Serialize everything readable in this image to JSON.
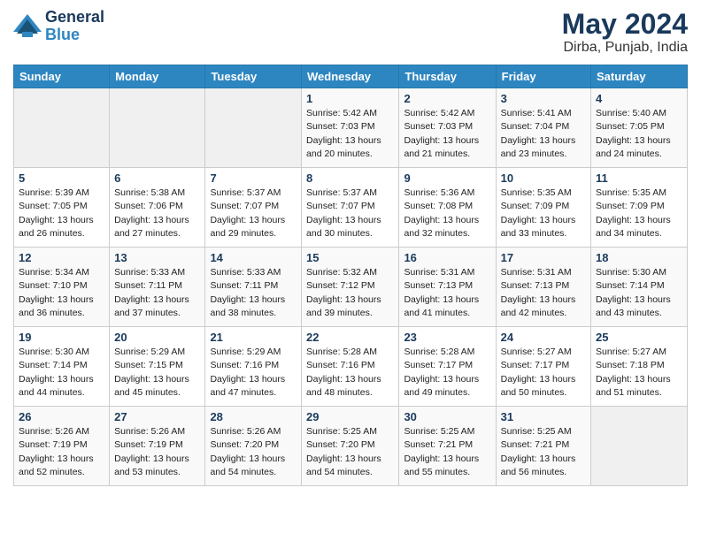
{
  "header": {
    "logo_line1": "General",
    "logo_line2": "Blue",
    "month_year": "May 2024",
    "location": "Dirba, Punjab, India"
  },
  "days_of_week": [
    "Sunday",
    "Monday",
    "Tuesday",
    "Wednesday",
    "Thursday",
    "Friday",
    "Saturday"
  ],
  "weeks": [
    [
      {
        "day": "",
        "info": ""
      },
      {
        "day": "",
        "info": ""
      },
      {
        "day": "",
        "info": ""
      },
      {
        "day": "1",
        "info": "Sunrise: 5:42 AM\nSunset: 7:03 PM\nDaylight: 13 hours\nand 20 minutes."
      },
      {
        "day": "2",
        "info": "Sunrise: 5:42 AM\nSunset: 7:03 PM\nDaylight: 13 hours\nand 21 minutes."
      },
      {
        "day": "3",
        "info": "Sunrise: 5:41 AM\nSunset: 7:04 PM\nDaylight: 13 hours\nand 23 minutes."
      },
      {
        "day": "4",
        "info": "Sunrise: 5:40 AM\nSunset: 7:05 PM\nDaylight: 13 hours\nand 24 minutes."
      }
    ],
    [
      {
        "day": "5",
        "info": "Sunrise: 5:39 AM\nSunset: 7:05 PM\nDaylight: 13 hours\nand 26 minutes."
      },
      {
        "day": "6",
        "info": "Sunrise: 5:38 AM\nSunset: 7:06 PM\nDaylight: 13 hours\nand 27 minutes."
      },
      {
        "day": "7",
        "info": "Sunrise: 5:37 AM\nSunset: 7:07 PM\nDaylight: 13 hours\nand 29 minutes."
      },
      {
        "day": "8",
        "info": "Sunrise: 5:37 AM\nSunset: 7:07 PM\nDaylight: 13 hours\nand 30 minutes."
      },
      {
        "day": "9",
        "info": "Sunrise: 5:36 AM\nSunset: 7:08 PM\nDaylight: 13 hours\nand 32 minutes."
      },
      {
        "day": "10",
        "info": "Sunrise: 5:35 AM\nSunset: 7:09 PM\nDaylight: 13 hours\nand 33 minutes."
      },
      {
        "day": "11",
        "info": "Sunrise: 5:35 AM\nSunset: 7:09 PM\nDaylight: 13 hours\nand 34 minutes."
      }
    ],
    [
      {
        "day": "12",
        "info": "Sunrise: 5:34 AM\nSunset: 7:10 PM\nDaylight: 13 hours\nand 36 minutes."
      },
      {
        "day": "13",
        "info": "Sunrise: 5:33 AM\nSunset: 7:11 PM\nDaylight: 13 hours\nand 37 minutes."
      },
      {
        "day": "14",
        "info": "Sunrise: 5:33 AM\nSunset: 7:11 PM\nDaylight: 13 hours\nand 38 minutes."
      },
      {
        "day": "15",
        "info": "Sunrise: 5:32 AM\nSunset: 7:12 PM\nDaylight: 13 hours\nand 39 minutes."
      },
      {
        "day": "16",
        "info": "Sunrise: 5:31 AM\nSunset: 7:13 PM\nDaylight: 13 hours\nand 41 minutes."
      },
      {
        "day": "17",
        "info": "Sunrise: 5:31 AM\nSunset: 7:13 PM\nDaylight: 13 hours\nand 42 minutes."
      },
      {
        "day": "18",
        "info": "Sunrise: 5:30 AM\nSunset: 7:14 PM\nDaylight: 13 hours\nand 43 minutes."
      }
    ],
    [
      {
        "day": "19",
        "info": "Sunrise: 5:30 AM\nSunset: 7:14 PM\nDaylight: 13 hours\nand 44 minutes."
      },
      {
        "day": "20",
        "info": "Sunrise: 5:29 AM\nSunset: 7:15 PM\nDaylight: 13 hours\nand 45 minutes."
      },
      {
        "day": "21",
        "info": "Sunrise: 5:29 AM\nSunset: 7:16 PM\nDaylight: 13 hours\nand 47 minutes."
      },
      {
        "day": "22",
        "info": "Sunrise: 5:28 AM\nSunset: 7:16 PM\nDaylight: 13 hours\nand 48 minutes."
      },
      {
        "day": "23",
        "info": "Sunrise: 5:28 AM\nSunset: 7:17 PM\nDaylight: 13 hours\nand 49 minutes."
      },
      {
        "day": "24",
        "info": "Sunrise: 5:27 AM\nSunset: 7:17 PM\nDaylight: 13 hours\nand 50 minutes."
      },
      {
        "day": "25",
        "info": "Sunrise: 5:27 AM\nSunset: 7:18 PM\nDaylight: 13 hours\nand 51 minutes."
      }
    ],
    [
      {
        "day": "26",
        "info": "Sunrise: 5:26 AM\nSunset: 7:19 PM\nDaylight: 13 hours\nand 52 minutes."
      },
      {
        "day": "27",
        "info": "Sunrise: 5:26 AM\nSunset: 7:19 PM\nDaylight: 13 hours\nand 53 minutes."
      },
      {
        "day": "28",
        "info": "Sunrise: 5:26 AM\nSunset: 7:20 PM\nDaylight: 13 hours\nand 54 minutes."
      },
      {
        "day": "29",
        "info": "Sunrise: 5:25 AM\nSunset: 7:20 PM\nDaylight: 13 hours\nand 54 minutes."
      },
      {
        "day": "30",
        "info": "Sunrise: 5:25 AM\nSunset: 7:21 PM\nDaylight: 13 hours\nand 55 minutes."
      },
      {
        "day": "31",
        "info": "Sunrise: 5:25 AM\nSunset: 7:21 PM\nDaylight: 13 hours\nand 56 minutes."
      },
      {
        "day": "",
        "info": ""
      }
    ]
  ]
}
